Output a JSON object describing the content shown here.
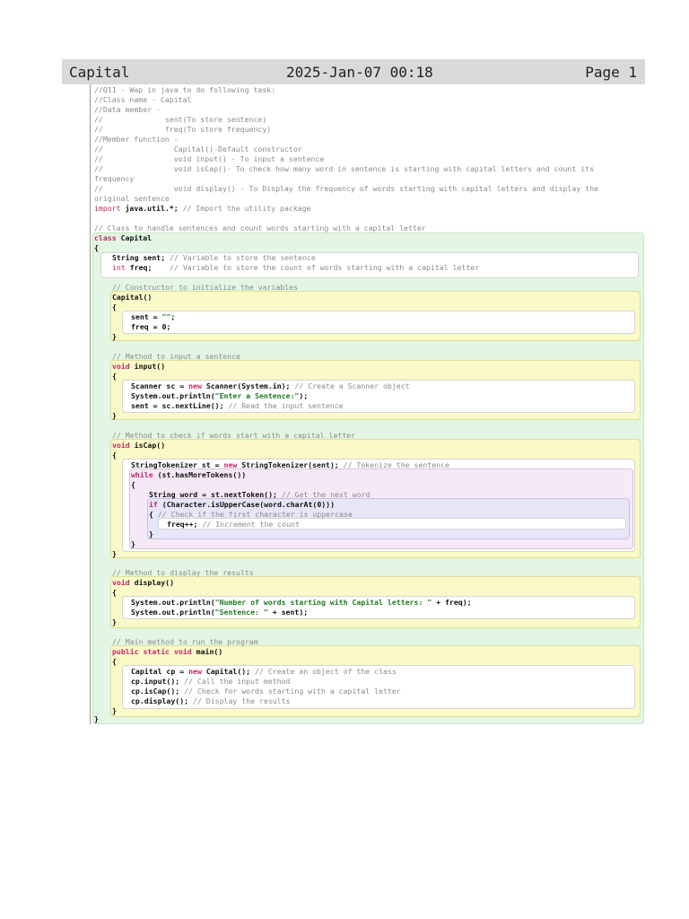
{
  "header": {
    "title": "Capital",
    "date": "2025-Jan-07 00:18",
    "page": "Page 1"
  },
  "code": {
    "lines": [
      {
        "id": "l1",
        "text": "//Q11 - Wap in java to do following task:"
      },
      {
        "id": "l2",
        "text": "//Class name - Capital"
      },
      {
        "id": "l3",
        "text": "//Data member -"
      },
      {
        "id": "l4",
        "text": "//              sent(To store sentence)"
      },
      {
        "id": "l5",
        "text": "//              freq(To store frequency)"
      },
      {
        "id": "l6",
        "text": "//Member function -"
      },
      {
        "id": "l7",
        "text": "//                Capital()-Default constructor"
      },
      {
        "id": "l8",
        "text": "//                void input() - To input a sentence"
      },
      {
        "id": "l9",
        "text": "//                void isCap()- To check how many word in sentence is starting with capital letters and count its"
      },
      {
        "id": "l10",
        "text": "frequency"
      },
      {
        "id": "l11",
        "text": "//                void display() - To Display the frequency of words starting with capital letters and display the"
      },
      {
        "id": "l12",
        "text": "original sentence"
      },
      {
        "id": "l13a",
        "text": "import"
      },
      {
        "id": "l13b",
        "text": " java.util.*; "
      },
      {
        "id": "l13c",
        "text": "// Import the utility package"
      },
      {
        "id": "l14",
        "text": "// Class to handle sentences and count words starting with a capital letter"
      },
      {
        "id": "l15a",
        "text": "class"
      },
      {
        "id": "l15b",
        "text": " Capital"
      },
      {
        "id": "l16",
        "text": "{"
      },
      {
        "id": "l17a",
        "text": "String sent; "
      },
      {
        "id": "l17b",
        "text": "// Variable to store the sentence"
      },
      {
        "id": "l18a",
        "text": "int"
      },
      {
        "id": "l18b",
        "text": " freq;    "
      },
      {
        "id": "l18c",
        "text": "// Variable to store the count of words starting with a capital letter"
      },
      {
        "id": "l19",
        "text": "// Constructor to initialize the variables"
      },
      {
        "id": "l20",
        "text": "Capital()"
      },
      {
        "id": "l21",
        "text": "{"
      },
      {
        "id": "l22a",
        "text": "sent = "
      },
      {
        "id": "l22b",
        "text": "\"\""
      },
      {
        "id": "l22c",
        "text": ";"
      },
      {
        "id": "l23",
        "text": "freq = 0;"
      },
      {
        "id": "l24",
        "text": "}"
      },
      {
        "id": "l25",
        "text": "// Method to input a sentence"
      },
      {
        "id": "l26a",
        "text": "void"
      },
      {
        "id": "l26b",
        "text": " input()"
      },
      {
        "id": "l27",
        "text": "{"
      },
      {
        "id": "l28a",
        "text": "Scanner sc = "
      },
      {
        "id": "l28b",
        "text": "new"
      },
      {
        "id": "l28c",
        "text": " Scanner(System.in); "
      },
      {
        "id": "l28d",
        "text": "// Create a Scanner object"
      },
      {
        "id": "l29a",
        "text": "System.out.println("
      },
      {
        "id": "l29b",
        "text": "\"Enter a Sentence:\""
      },
      {
        "id": "l29c",
        "text": ");"
      },
      {
        "id": "l30a",
        "text": "sent = sc.nextLine(); "
      },
      {
        "id": "l30b",
        "text": "// Read the input sentence"
      },
      {
        "id": "l31",
        "text": "}"
      },
      {
        "id": "l32",
        "text": "// Method to check if words start with a capital letter"
      },
      {
        "id": "l33a",
        "text": "void"
      },
      {
        "id": "l33b",
        "text": " isCap()"
      },
      {
        "id": "l34",
        "text": "{"
      },
      {
        "id": "l35a",
        "text": "StringTokenizer st = "
      },
      {
        "id": "l35b",
        "text": "new"
      },
      {
        "id": "l35c",
        "text": " StringTokenizer(sent); "
      },
      {
        "id": "l35d",
        "text": "// Tokenize the sentence"
      },
      {
        "id": "l36a",
        "text": "while"
      },
      {
        "id": "l36b",
        "text": " (st.hasMoreTokens())"
      },
      {
        "id": "l37",
        "text": "{"
      },
      {
        "id": "l38a",
        "text": "String word = st.nextToken(); "
      },
      {
        "id": "l38b",
        "text": "// Get the next word"
      },
      {
        "id": "l39a",
        "text": "if"
      },
      {
        "id": "l39b",
        "text": " (Character.isUpperCase(word.charAt(0)))"
      },
      {
        "id": "l40a",
        "text": "{ "
      },
      {
        "id": "l40b",
        "text": "// Check if the first character is uppercase"
      },
      {
        "id": "l41a",
        "text": "freq++; "
      },
      {
        "id": "l41b",
        "text": "// Increment the count"
      },
      {
        "id": "l42",
        "text": "}"
      },
      {
        "id": "l43",
        "text": "}"
      },
      {
        "id": "l44",
        "text": "}"
      },
      {
        "id": "l45",
        "text": "// Method to display the results"
      },
      {
        "id": "l46a",
        "text": "void"
      },
      {
        "id": "l46b",
        "text": " display()"
      },
      {
        "id": "l47",
        "text": "{"
      },
      {
        "id": "l48a",
        "text": "System.out.println("
      },
      {
        "id": "l48b",
        "text": "\"Number of words starting with Capital letters: \""
      },
      {
        "id": "l48c",
        "text": " + freq);"
      },
      {
        "id": "l49a",
        "text": "System.out.println("
      },
      {
        "id": "l49b",
        "text": "\"Sentence: \""
      },
      {
        "id": "l49c",
        "text": " + sent);"
      },
      {
        "id": "l50",
        "text": "}"
      },
      {
        "id": "l51",
        "text": "// Main method to run the program"
      },
      {
        "id": "l52a",
        "text": "public static void"
      },
      {
        "id": "l52b",
        "text": " main()"
      },
      {
        "id": "l53",
        "text": "{"
      },
      {
        "id": "l54a",
        "text": "Capital cp = "
      },
      {
        "id": "l54b",
        "text": "new"
      },
      {
        "id": "l54c",
        "text": " Capital(); "
      },
      {
        "id": "l54d",
        "text": "// Create an object of the class"
      },
      {
        "id": "l55a",
        "text": "cp.input(); "
      },
      {
        "id": "l55b",
        "text": "// Call the input method"
      },
      {
        "id": "l56a",
        "text": "cp.isCap(); "
      },
      {
        "id": "l56b",
        "text": "// Check for words starting with a capital letter"
      },
      {
        "id": "l57a",
        "text": "cp.display(); "
      },
      {
        "id": "l57b",
        "text": "// Display the results"
      },
      {
        "id": "l58",
        "text": "}"
      },
      {
        "id": "l59",
        "text": "}"
      }
    ]
  }
}
